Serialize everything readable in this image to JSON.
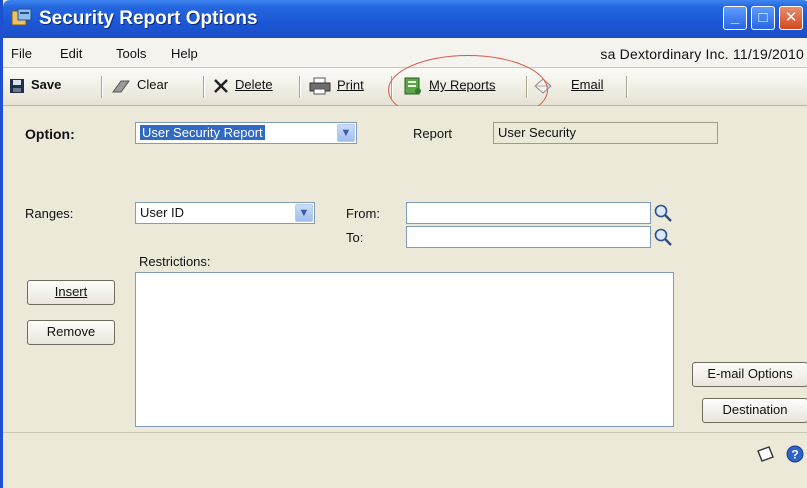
{
  "window": {
    "title": "Security Report Options"
  },
  "menu": {
    "items": [
      "File",
      "Edit",
      "Tools",
      "Help"
    ],
    "user_info": "sa  Dextordinary Inc.  11/19/2010"
  },
  "toolbar": {
    "save": "Save",
    "clear": "Clear",
    "delete": "Delete",
    "print": "Print",
    "my_reports": "My Reports",
    "email": "Email"
  },
  "form": {
    "option_label": "Option:",
    "option_value": "User Security Report",
    "report_label": "Report",
    "report_value": "User Security",
    "ranges_label": "Ranges:",
    "ranges_value": "User ID",
    "from_label": "From:",
    "from_value": "",
    "to_label": "To:",
    "to_value": "",
    "restrictions_label": "Restrictions:",
    "restrictions_value": ""
  },
  "buttons": {
    "insert": "Insert",
    "remove": "Remove",
    "email_options": "E-mail Options",
    "destination": "Destination"
  },
  "colors": {
    "titlebar": "#1b57d6",
    "window_bg": "#ece9d8",
    "highlight_oval": "#d9584a",
    "selection": "#316ac5"
  }
}
